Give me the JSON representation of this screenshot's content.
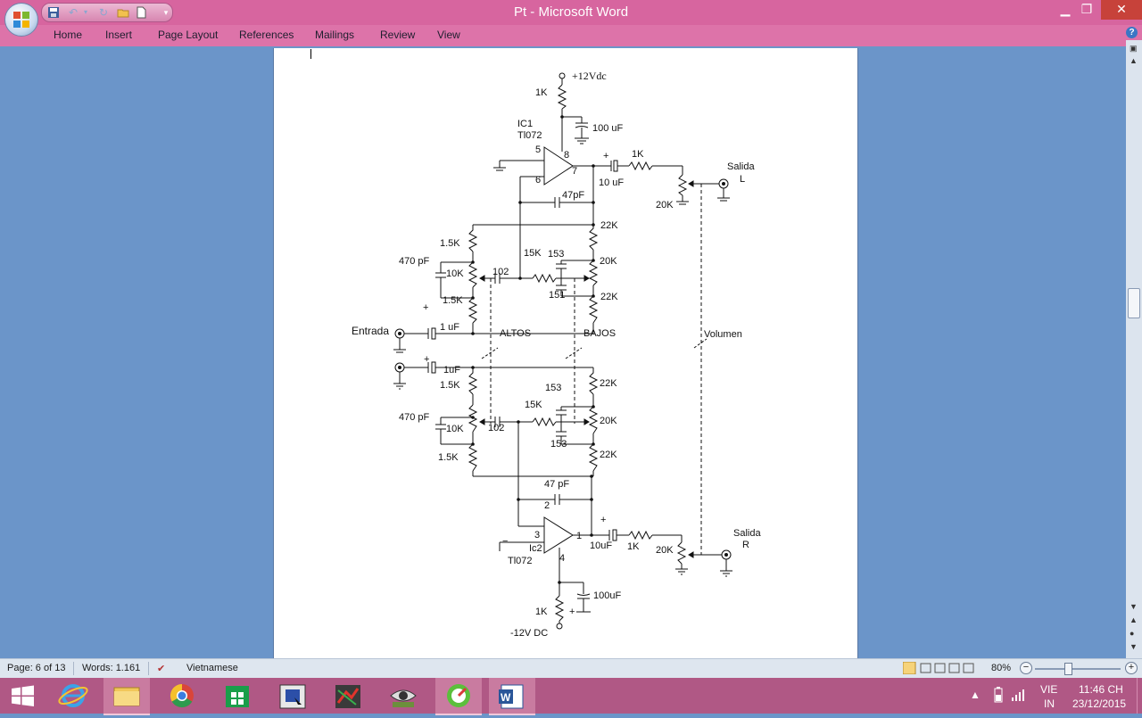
{
  "window": {
    "title": "Pt - Microsoft Word"
  },
  "quick_access": {
    "icons": [
      "save-icon",
      "undo-icon",
      "redo-icon",
      "open-folder-icon",
      "new-document-icon",
      "customize-dropdown-icon"
    ]
  },
  "ribbon": {
    "tabs": [
      {
        "label": "Home"
      },
      {
        "label": "Insert"
      },
      {
        "label": "Page Layout"
      },
      {
        "label": "References"
      },
      {
        "label": "Mailings"
      },
      {
        "label": "Review"
      },
      {
        "label": "View"
      }
    ]
  },
  "schematic": {
    "supply_top": "+12Vdc",
    "supply_bottom": "-12V DC",
    "ic1_name": "IC1",
    "ic1_part": "Tl072",
    "ic2_name": "Ic2",
    "ic2_part": "Tl072",
    "labels": {
      "r_1k_top": "1K",
      "c_100uf_top": "100 uF",
      "pin5": "5",
      "pin8": "8",
      "pin6": "6",
      "pin7": "7",
      "plus1": "+",
      "r_1k_out_l": "1K",
      "c_10uf_l": "10 uF",
      "salida_l": "Salida",
      "channel_l": "L",
      "pot_20k_l": "20K",
      "c_47pf_top": "47pF",
      "r_22k_1": "22K",
      "r_15k_a": "1.5K",
      "c_470pf_a": "470 pF",
      "pot_10k_a": "10K",
      "c_102_a": "102",
      "r_15k_mid_a": "15K",
      "c_153_a": "153",
      "pot_20k_a": "20K",
      "r_15k_b": "1.5K",
      "c_151": "151",
      "r_22k_2": "22K",
      "plus2": "+",
      "entrada": "Entrada",
      "c_1uf": "1 uF",
      "altos": "ALTOS",
      "bajos": "BAJOS",
      "volumen": "Volumen",
      "plus3": "+",
      "c_1uf_b": "1uF",
      "r_15k_c": "1.5K",
      "c_153_b": "153",
      "r_22k_3": "22K",
      "c_470pf_b": "470 pF",
      "r_15k_mid_b": "15K",
      "pot_20k_b": "20K",
      "pot_10k_b": "10K",
      "c_102_b": "102",
      "c_153_c": "153",
      "r_15k_d": "1.5K",
      "r_22k_4": "22K",
      "c_47pf_bot": "47 pF",
      "pin2": "2",
      "pin3": "3",
      "pin1": "1",
      "pin4": "4",
      "plus4": "+",
      "c_10uf_r": "10uF",
      "r_1k_out_r": "1K",
      "pot_20k_r": "20K",
      "salida_r": "Salida",
      "channel_r": "R",
      "c_100uf_bot": "100uF",
      "r_1k_bot": "1K",
      "plus5": "+",
      "minus1": "−"
    }
  },
  "status": {
    "page": "Page: 6 of 13",
    "words": "Words: 1.161",
    "language": "Vietnamese",
    "zoom": "80%"
  },
  "taskbar": {
    "apps": [
      "windows-start-icon",
      "internet-explorer-icon",
      "file-explorer-icon",
      "chrome-icon",
      "store-icon",
      "circuit-app-icon",
      "pcb-app-icon",
      "eye-app-icon",
      "green-app-icon",
      "word-icon"
    ],
    "lang_top": "VIE",
    "lang_bottom": "IN",
    "time": "11:46 CH",
    "date": "23/12/2015"
  }
}
